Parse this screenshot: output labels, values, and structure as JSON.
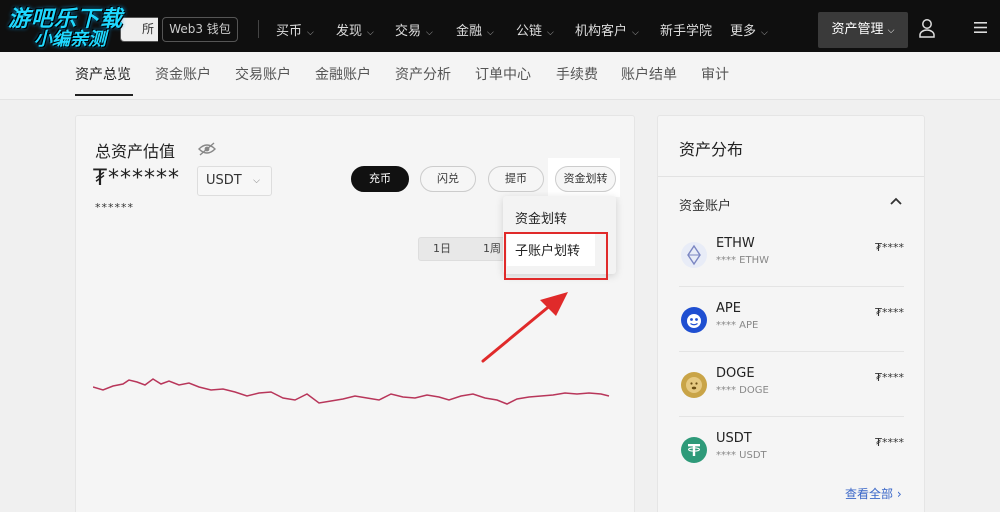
{
  "watermark": {
    "line1": "游吧乐下载",
    "line2": "小编亲测"
  },
  "topbar": {
    "exchange_tab": "所",
    "web3_tab": "Web3 钱包",
    "nav": [
      {
        "label": "买币"
      },
      {
        "label": "发现"
      },
      {
        "label": "交易"
      },
      {
        "label": "金融"
      },
      {
        "label": "公链"
      },
      {
        "label": "机构客户"
      },
      {
        "label": "新手学院"
      },
      {
        "label": "更多"
      }
    ],
    "asset_management": "资产管理"
  },
  "subtabs": [
    "资产总览",
    "资金账户",
    "交易账户",
    "金融账户",
    "资产分析",
    "订单中心",
    "手续费",
    "账户结单",
    "审计"
  ],
  "overview": {
    "title": "总资产估值",
    "amount": "₮******",
    "sub_amount": "******",
    "currency": "USDT",
    "actions": {
      "deposit": "充币",
      "convert": "闪兑",
      "withdraw": "提币",
      "transfer": "资金划转"
    },
    "periods": {
      "day": "1日",
      "week": "1周"
    },
    "dropdown": {
      "item1": "资金划转",
      "item2": "子账户划转"
    }
  },
  "distribution": {
    "title": "资产分布",
    "account_label": "资金账户",
    "assets": [
      {
        "name": "ETHW",
        "sub": "**** ETHW",
        "value": "₮****",
        "icon": "ethw-icon",
        "color": "#e8ecf7"
      },
      {
        "name": "APE",
        "sub": "**** APE",
        "value": "₮****",
        "icon": "ape-icon",
        "color": "#1f4fd1"
      },
      {
        "name": "DOGE",
        "sub": "**** DOGE",
        "value": "₮****",
        "icon": "doge-icon",
        "color": "#c9a447"
      },
      {
        "name": "USDT",
        "sub": "**** USDT",
        "value": "₮****",
        "icon": "tether-icon",
        "color": "#2e9a79"
      }
    ],
    "view_all": "查看全部 ›"
  },
  "colors": {
    "accent_dark": "#111111",
    "annotation_red": "#e02a2a",
    "chart_line": "#b8365a",
    "link_blue": "#3a67c8"
  }
}
